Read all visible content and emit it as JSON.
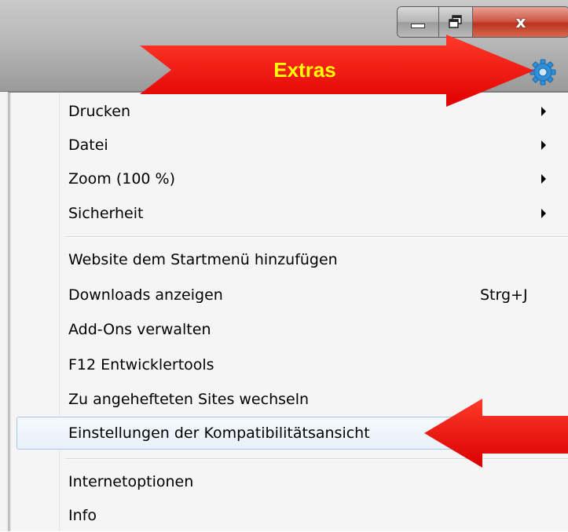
{
  "annotation": {
    "extras_label": "Extras"
  },
  "window_controls": {
    "minimize": "minimize-icon",
    "maximize": "maximize-icon",
    "close": "close-icon",
    "close_glyph": "x"
  },
  "toolbar": {
    "tools_icon": "gear-icon",
    "search_icon": "search-icon"
  },
  "menu": {
    "group1": [
      {
        "label": "Drucken",
        "submenu": true
      },
      {
        "label": "Datei",
        "submenu": true
      },
      {
        "label": "Zoom (100 %)",
        "submenu": true
      },
      {
        "label": "Sicherheit",
        "submenu": true
      }
    ],
    "group2": [
      {
        "label": "Website dem Startmenü hinzufügen"
      },
      {
        "label": "Downloads anzeigen",
        "shortcut": "Strg+J"
      },
      {
        "label": "Add-Ons verwalten"
      },
      {
        "label": "F12 Entwicklertools"
      },
      {
        "label": "Zu angehefteten Sites wechseln"
      },
      {
        "label": "Einstellungen der Kompatibilitätsansicht",
        "highlighted": true
      }
    ],
    "group3": [
      {
        "label": "Internetoptionen"
      },
      {
        "label": "Info"
      }
    ]
  },
  "colors": {
    "arrow": "#ff0000",
    "arrow_text": "#ffff00",
    "highlight_border": "#a8c8eb",
    "gear": "#2f8fd8"
  }
}
